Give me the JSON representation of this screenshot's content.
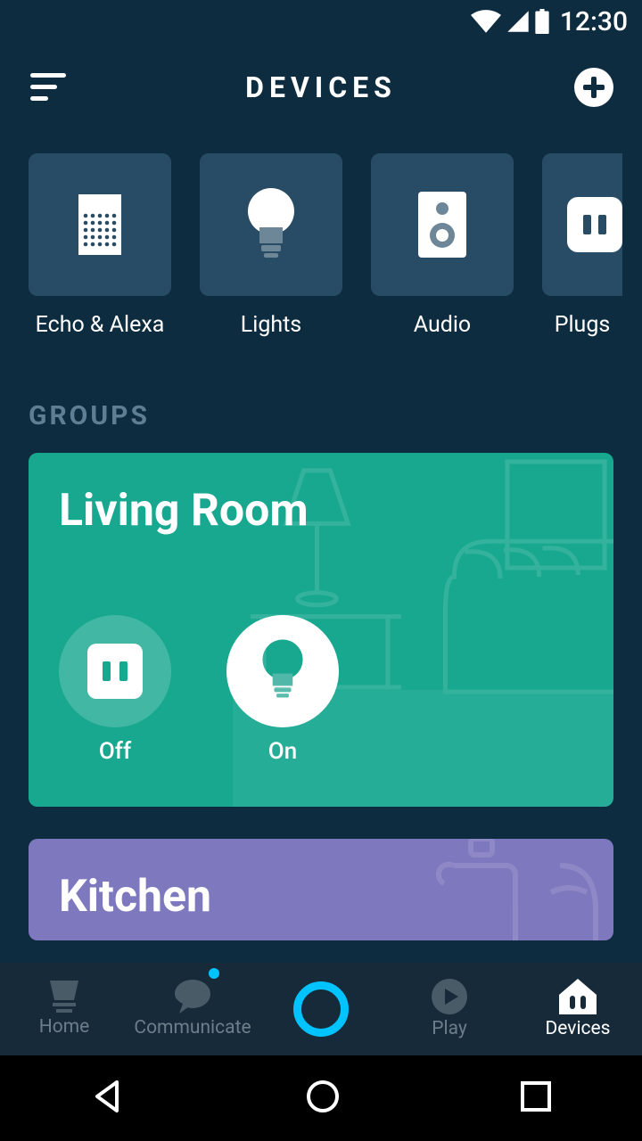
{
  "status": {
    "time": "12:30"
  },
  "header": {
    "title": "DEVICES"
  },
  "categories": [
    {
      "id": "echo",
      "label": "Echo & Alexa"
    },
    {
      "id": "lights",
      "label": "Lights"
    },
    {
      "id": "audio",
      "label": "Audio"
    },
    {
      "id": "plugs",
      "label": "Plugs"
    }
  ],
  "section_groups_title": "GROUPS",
  "groups": [
    {
      "id": "living",
      "name": "Living Room",
      "controls": [
        {
          "id": "plug",
          "label": "Off",
          "state": "off"
        },
        {
          "id": "light",
          "label": "On",
          "state": "on"
        }
      ]
    },
    {
      "id": "kitchen",
      "name": "Kitchen"
    }
  ],
  "bottom_nav": {
    "home": "Home",
    "communicate": "Communicate",
    "play": "Play",
    "devices": "Devices"
  }
}
